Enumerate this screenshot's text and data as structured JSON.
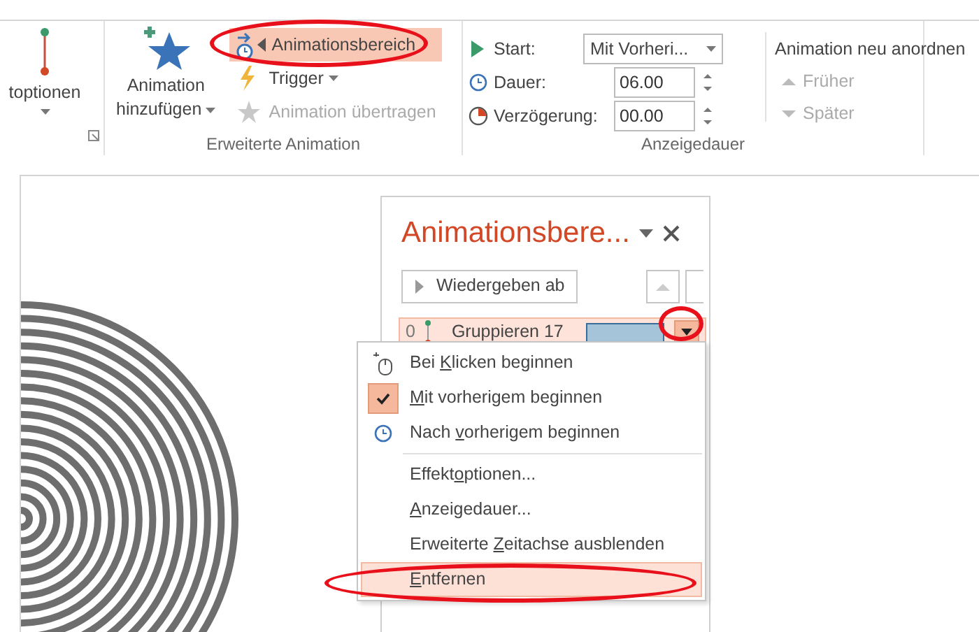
{
  "ribbon": {
    "partial_group": {
      "label": "toptionen"
    },
    "advanced": {
      "title": "Erweiterte Animation",
      "add_button": {
        "lines": [
          "Animation",
          "hinzufügen"
        ]
      },
      "small_buttons": [
        {
          "kind": "pane",
          "label": "Animationsbereich",
          "active": true,
          "disabled": false,
          "dropdown": false
        },
        {
          "kind": "trigger",
          "label": "Trigger",
          "active": false,
          "disabled": false,
          "dropdown": true
        },
        {
          "kind": "painter",
          "label": "Animation übertragen",
          "active": false,
          "disabled": true,
          "dropdown": false
        }
      ]
    },
    "timing": {
      "title": "Anzeigedauer",
      "fields": [
        {
          "kind": "start",
          "label": "Start:",
          "value": "Mit Vorheri..."
        },
        {
          "kind": "duration",
          "label": "Dauer:",
          "value": "06.00"
        },
        {
          "kind": "delay",
          "label": "Verzögerung:",
          "value": "00.00"
        }
      ],
      "reorder": {
        "title": "Animation neu anordnen",
        "buttons": [
          {
            "kind": "up",
            "label": "Früher",
            "disabled": true
          },
          {
            "kind": "down",
            "label": "Später",
            "disabled": true
          }
        ]
      }
    }
  },
  "pane": {
    "title": "Animationsbere...",
    "play_button": {
      "label": "Wiedergeben ab"
    },
    "move_up": {
      "disabled": true
    },
    "items": [
      {
        "number": "0",
        "label": "Gruppieren 17",
        "selected": true
      }
    ]
  },
  "menu": {
    "items": [
      {
        "kind": "click",
        "label": {
          "before": "Bei ",
          "key": "K",
          "after": "licken beginnen"
        },
        "checked": false,
        "highlighted": false
      },
      {
        "kind": "with",
        "label": {
          "key": "M",
          "after": "it vorherigem beginnen"
        },
        "checked": true,
        "highlighted": false
      },
      {
        "kind": "after",
        "label": {
          "before": "Nach ",
          "key": "v",
          "after": "orherigem beginnen"
        },
        "checked": false,
        "highlighted": false
      },
      {
        "kind": "command",
        "label": {
          "before": "Effekt",
          "key": "o",
          "after": "ptionen..."
        },
        "checked": false,
        "highlighted": false
      },
      {
        "kind": "command",
        "label": {
          "key": "A",
          "after": "nzeigedauer..."
        },
        "checked": false,
        "highlighted": false
      },
      {
        "kind": "command",
        "label": {
          "before": "Erweiterte ",
          "key": "Z",
          "after": "eitachse ausblenden"
        },
        "checked": false,
        "highlighted": false
      },
      {
        "kind": "command",
        "label": {
          "key": "E",
          "after": "ntfernen"
        },
        "checked": false,
        "highlighted": true
      }
    ]
  }
}
